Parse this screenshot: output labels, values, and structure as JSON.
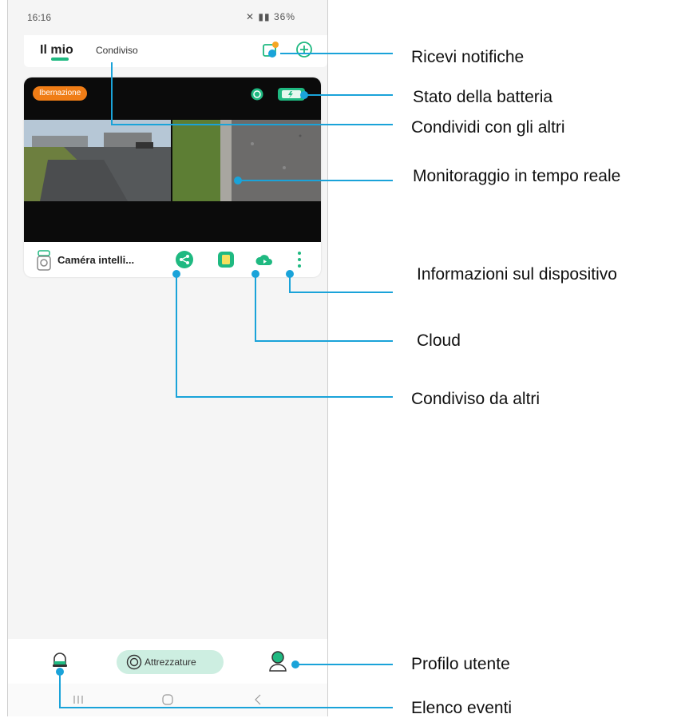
{
  "status_bar": {
    "time": "16:16",
    "icons": "⨯ ☰ ◢ 36%▮",
    "battery": "36%"
  },
  "header": {
    "tab_mine": "Il mio",
    "tab_shared": "Condiviso",
    "notification_icon": "card-notify-icon",
    "add_icon": "plus-circle-icon"
  },
  "device_card": {
    "status_badge": "Ibernazione",
    "name": "Caméra intelli...",
    "actions": [
      "share-icon",
      "sd-card-icon",
      "cloud-icon",
      "more-vertical-icon"
    ]
  },
  "bottom_nav": {
    "events_icon": "bell-icon",
    "devices_label": "Attrezzature",
    "profile_icon": "user-icon"
  },
  "system_nav": [
    "recents",
    "home",
    "back"
  ],
  "callouts": [
    {
      "id": "notifications",
      "text": "Ricevi notifiche"
    },
    {
      "id": "battery",
      "text": "Stato della batteria"
    },
    {
      "id": "share_others",
      "text": "Condividi con gli altri"
    },
    {
      "id": "live",
      "text": "Monitoraggio in tempo reale"
    },
    {
      "id": "device_info",
      "text": "Informazioni sul dispositivo"
    },
    {
      "id": "cloud",
      "text": "Cloud"
    },
    {
      "id": "shared_by_others",
      "text": "Condiviso da altri"
    },
    {
      "id": "profile",
      "text": "Profilo utente"
    },
    {
      "id": "event_list",
      "text": "Elenco eventi"
    }
  ],
  "colors": {
    "accent": "#1fb981",
    "badge": "#f07d16",
    "callout_line": "#1aa3d9",
    "pill": "#cdeee1"
  }
}
